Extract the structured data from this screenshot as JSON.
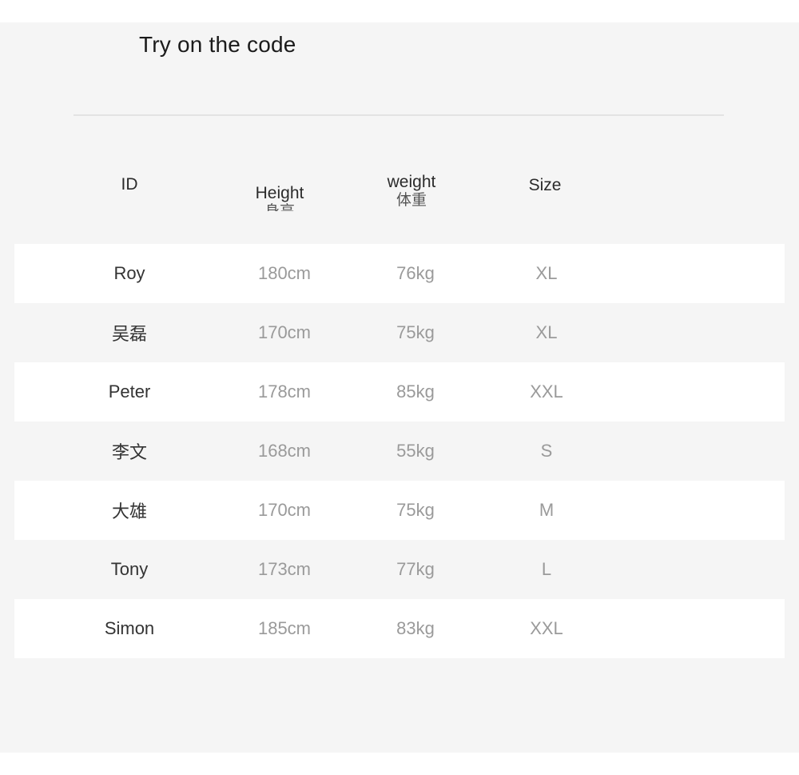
{
  "page": {
    "title": "Try on the code",
    "background_color": "#f5f5f5",
    "row_alt_color": "#ffffff",
    "divider_color": "#e3e3e3"
  },
  "table": {
    "columns": [
      {
        "key": "id",
        "label": "ID",
        "sub": ""
      },
      {
        "key": "height",
        "label": "Height",
        "sub": "身高"
      },
      {
        "key": "weight",
        "label": "weight",
        "sub": "体重"
      },
      {
        "key": "size",
        "label": "Size",
        "sub": ""
      }
    ],
    "rows": [
      {
        "id": "Roy",
        "height": "180cm",
        "weight": "76kg",
        "size": "XL"
      },
      {
        "id": "吴磊",
        "height": "170cm",
        "weight": "75kg",
        "size": "XL"
      },
      {
        "id": "Peter",
        "height": "178cm",
        "weight": "85kg",
        "size": "XXL"
      },
      {
        "id": "李文",
        "height": "168cm",
        "weight": "55kg",
        "size": "S"
      },
      {
        "id": "大雄",
        "height": "170cm",
        "weight": "75kg",
        "size": "M"
      },
      {
        "id": "Tony",
        "height": "173cm",
        "weight": "77kg",
        "size": "L"
      },
      {
        "id": "Simon",
        "height": "185cm",
        "weight": "83kg",
        "size": "XXL"
      }
    ]
  }
}
